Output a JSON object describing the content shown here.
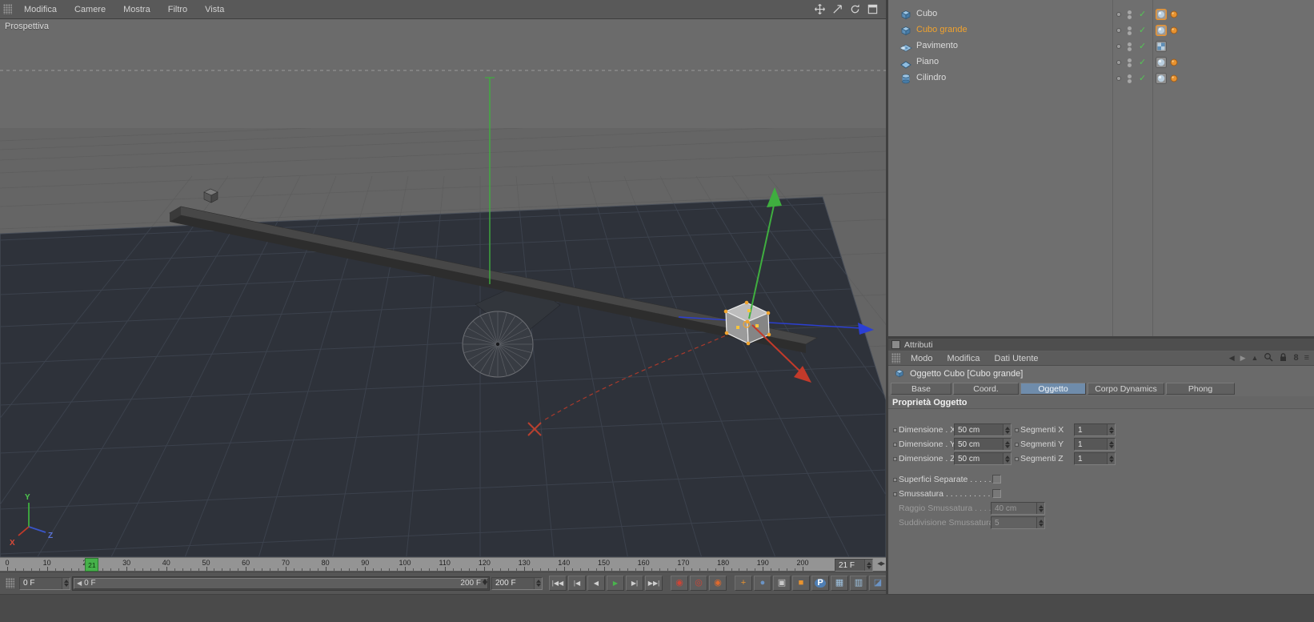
{
  "viewport": {
    "menu_items": [
      "Modifica",
      "Camere",
      "Mostra",
      "Filtro",
      "Vista"
    ],
    "nav_icons": [
      "pan-icon",
      "zoom-icon",
      "rotate-icon",
      "maximize-icon"
    ],
    "view_label": "Prospettiva",
    "axis_x": "X",
    "axis_y": "Y",
    "axis_z": "Z"
  },
  "object_manager": {
    "objects": [
      {
        "name": "Cubo",
        "icon": "cube",
        "selected": false,
        "enabled": true,
        "tags": [
          "phong-selected",
          "dynamics-dot"
        ]
      },
      {
        "name": "Cubo grande",
        "icon": "cube",
        "selected": true,
        "enabled": true,
        "tags": [
          "phong-selected",
          "dynamics-dot"
        ]
      },
      {
        "name": "Pavimento",
        "icon": "floor",
        "selected": false,
        "enabled": true,
        "tags": [
          "compositing"
        ]
      },
      {
        "name": "Piano",
        "icon": "plane",
        "selected": false,
        "enabled": true,
        "tags": [
          "phong",
          "dynamics-dot"
        ]
      },
      {
        "name": "Cilindro",
        "icon": "cylinder",
        "selected": false,
        "enabled": true,
        "tags": [
          "phong",
          "dynamics-dot"
        ]
      }
    ]
  },
  "attributes": {
    "panel_title": "Attributi",
    "menu_items": [
      "Modo",
      "Modifica",
      "Dati Utente"
    ],
    "menu_icons": [
      "back-icon",
      "forward-icon",
      "up-icon",
      "search-icon",
      "lock-icon",
      "link-icon",
      "menu-icon"
    ],
    "object_title": "Oggetto Cubo [Cubo grande]",
    "tabs": [
      {
        "label": "Base",
        "active": false
      },
      {
        "label": "Coord.",
        "active": false
      },
      {
        "label": "Oggetto",
        "active": true
      },
      {
        "label": "Corpo Dynamics",
        "active": false
      },
      {
        "label": "Phong",
        "active": false
      }
    ],
    "active_tab_color": "#6f8cab",
    "section_title": "Proprietà Oggetto",
    "dimension_rows": [
      {
        "label": "Dimensione . X",
        "value": "50 cm",
        "label2": "Segmenti X",
        "value2": "1"
      },
      {
        "label": "Dimensione . Y",
        "value": "50 cm",
        "label2": "Segmenti Y",
        "value2": "1"
      },
      {
        "label": "Dimensione . Z",
        "value": "50 cm",
        "label2": "Segmenti Z",
        "value2": "1"
      }
    ],
    "checkbox_rows": [
      {
        "label": "Superfici Separate . . . . .",
        "checked": false
      },
      {
        "label": "Smussatura  . . . . . . . . . .",
        "checked": false
      }
    ],
    "disabled_rows": [
      {
        "label": "Raggio Smussatura . . . .",
        "value": "40 cm"
      },
      {
        "label": "Suddivisione Smussatura",
        "value": "5"
      }
    ]
  },
  "timeline": {
    "tick_labels": [
      "0",
      "10",
      "20",
      "30",
      "40",
      "50",
      "60",
      "70",
      "80",
      "90",
      "100",
      "110",
      "120",
      "130",
      "140",
      "150",
      "160",
      "170",
      "180",
      "190",
      "200"
    ],
    "current_frame": "21",
    "frame_field": "21 F",
    "marker_color": "#46b14a"
  },
  "transport": {
    "start_field": "0 F",
    "range_start_label": "0 F",
    "range_end_label": "200 F",
    "end_field": "200 F",
    "playback": [
      {
        "name": "goto-start-button",
        "glyph": "|◀◀"
      },
      {
        "name": "prev-key-button",
        "glyph": "|◀"
      },
      {
        "name": "prev-frame-button",
        "glyph": "◀"
      },
      {
        "name": "play-button",
        "glyph": "▶",
        "color": "#49b54d"
      },
      {
        "name": "next-frame-button",
        "glyph": "▶|"
      },
      {
        "name": "goto-end-button",
        "glyph": "▶▶|"
      }
    ],
    "record": [
      {
        "name": "record-keyframe-button",
        "glyph": "◉",
        "color": "#cf4436"
      },
      {
        "name": "record-autokey-button",
        "glyph": "◎",
        "color": "#cf4436"
      },
      {
        "name": "record-options-button",
        "glyph": "◉",
        "color": "#e06a2e"
      }
    ],
    "tools": [
      {
        "name": "snap-toggle-button",
        "glyph": "+",
        "color": "#e8932f"
      },
      {
        "name": "quantize-button",
        "glyph": "●",
        "color": "#6b93c4"
      },
      {
        "name": "workplane-button",
        "glyph": "▣",
        "color": "#c8c8c8"
      },
      {
        "name": "lock-workplane-button",
        "glyph": "■",
        "color": "#e8932f"
      },
      {
        "name": "parent-mode-button",
        "glyph": "P",
        "color": "#ffffff",
        "bg": "#4f7fb5",
        "round": true
      },
      {
        "name": "grid-snap-button",
        "glyph": "▦",
        "color": "#9ec2df"
      },
      {
        "name": "viewport-filter-button",
        "glyph": "▥",
        "color": "#9ec2df"
      }
    ],
    "corner_icon": {
      "name": "timeline-layout-icon",
      "glyph": "◪",
      "color": "#6b93c4"
    }
  }
}
